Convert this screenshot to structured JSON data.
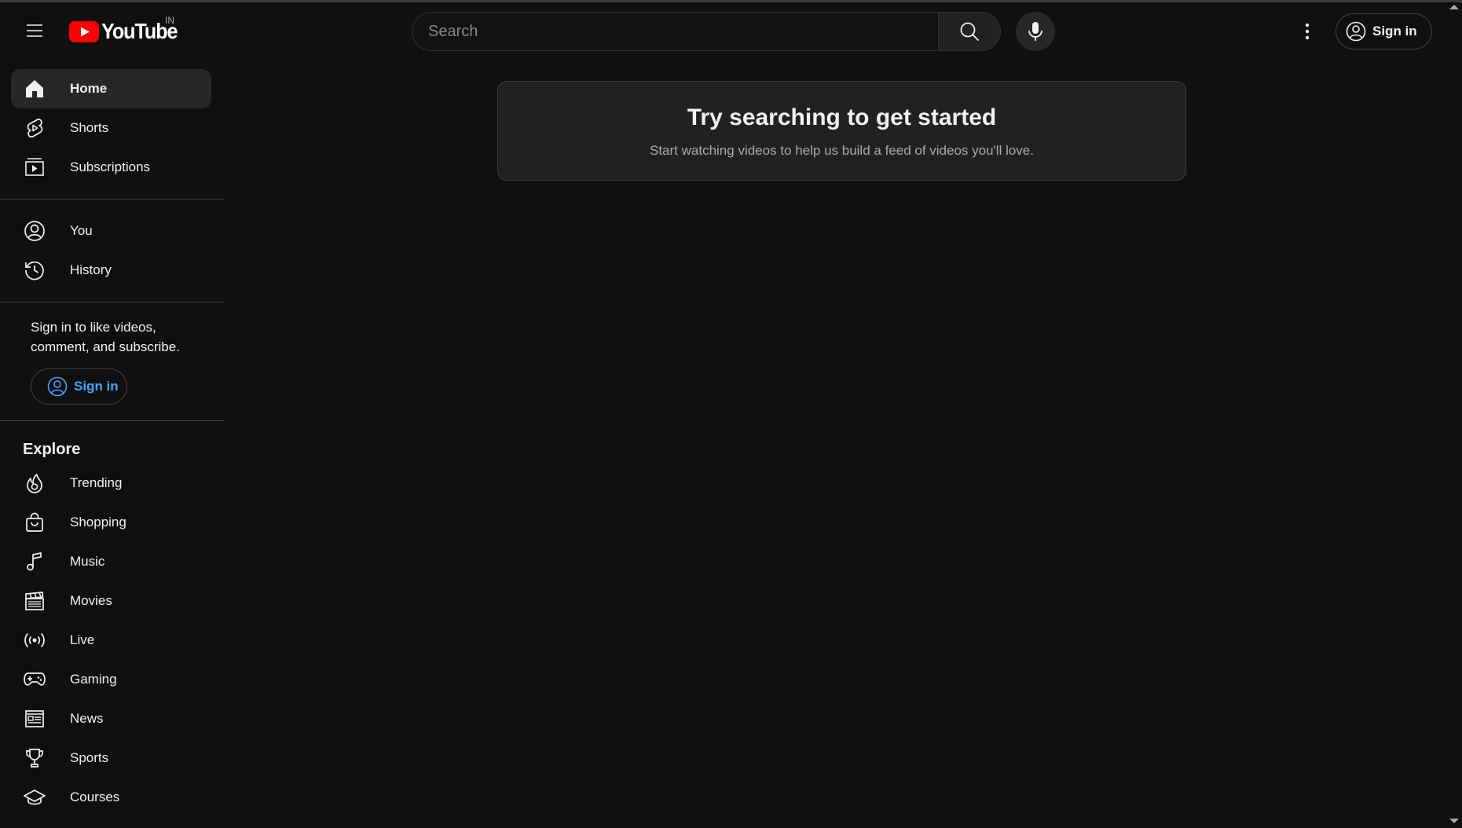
{
  "header": {
    "logo_text": "YouTube",
    "country_code": "IN",
    "search_placeholder": "Search",
    "signin_label": "Sign in"
  },
  "sidebar": {
    "main_items": [
      {
        "label": "Home",
        "icon": "home-icon",
        "active": true
      },
      {
        "label": "Shorts",
        "icon": "shorts-icon"
      },
      {
        "label": "Subscriptions",
        "icon": "subscriptions-icon"
      }
    ],
    "you_items": [
      {
        "label": "You",
        "icon": "account-circle-icon"
      },
      {
        "label": "History",
        "icon": "history-icon"
      }
    ],
    "signin_prompt": "Sign in to like videos, comment, and subscribe.",
    "signin_label": "Sign in",
    "explore_title": "Explore",
    "explore_items": [
      {
        "label": "Trending",
        "icon": "trending-icon"
      },
      {
        "label": "Shopping",
        "icon": "shopping-bag-icon"
      },
      {
        "label": "Music",
        "icon": "music-note-icon"
      },
      {
        "label": "Movies",
        "icon": "clapperboard-icon"
      },
      {
        "label": "Live",
        "icon": "live-broadcast-icon"
      },
      {
        "label": "Gaming",
        "icon": "gamepad-icon"
      },
      {
        "label": "News",
        "icon": "newspaper-icon"
      },
      {
        "label": "Sports",
        "icon": "trophy-icon"
      },
      {
        "label": "Courses",
        "icon": "graduation-cap-icon"
      }
    ]
  },
  "main": {
    "card_title": "Try searching to get started",
    "card_subtitle": "Start watching videos to help us build a feed of videos you'll love."
  },
  "colors": {
    "background": "#0f0f0f",
    "accent_red": "#ff0000",
    "link_blue": "#3ea6ff"
  }
}
